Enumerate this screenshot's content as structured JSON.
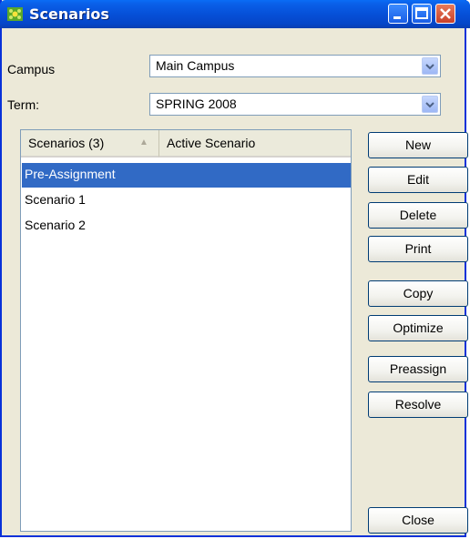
{
  "window": {
    "title": "Scenarios",
    "icon": "app-flower-icon"
  },
  "titlebar_buttons": {
    "minimize": "minimize-icon",
    "maximize": "maximize-icon",
    "close": "close-icon"
  },
  "filters": {
    "campus_label": "Campus",
    "campus_value": "Main Campus",
    "term_label": "Term:",
    "term_value": "SPRING 2008"
  },
  "list": {
    "columns": [
      "Scenarios (3)",
      "Active Scenario"
    ],
    "sort_indicator": "▲",
    "rows": [
      "Pre-Assignment",
      "Scenario 1",
      "Scenario 2"
    ],
    "selected_index": 0
  },
  "buttons": {
    "new": "New",
    "edit": "Edit",
    "delete": "Delete",
    "print": "Print",
    "copy": "Copy",
    "optimize": "Optimize",
    "preassign": "Preassign",
    "resolve": "Resolve",
    "close": "Close"
  },
  "colors": {
    "title_blue": "#0650d8",
    "selection": "#316ac5",
    "window_bg": "#ece9d8"
  }
}
